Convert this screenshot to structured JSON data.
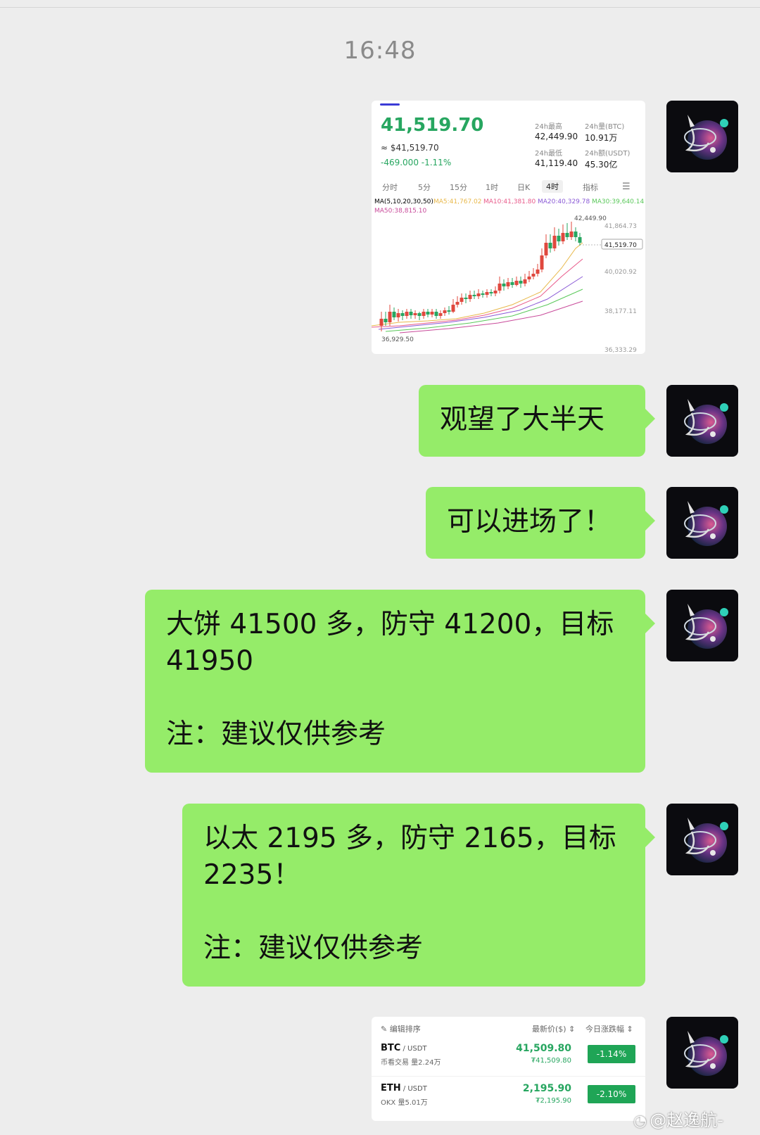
{
  "time": "16:48",
  "chart_card": {
    "price": "41,519.70",
    "usd": "≈ $41,519.70",
    "change": "-469.000  -1.11%",
    "stats": [
      {
        "label": "24h最高",
        "value": "42,449.90"
      },
      {
        "label": "24h量(BTC)",
        "value": "10.91万"
      },
      {
        "label": "24h最低",
        "value": "41,119.40"
      },
      {
        "label": "24h额(USDT)",
        "value": "45.30亿"
      }
    ],
    "tabs": [
      "分时",
      "5分",
      "15分",
      "1时",
      "日K",
      "4时",
      "指标"
    ],
    "active_tab": "4时",
    "ma_labels": [
      {
        "text": "MA(5,10,20,30,50)",
        "color": "#555555"
      },
      {
        "text": "MA5:41,767.02",
        "color": "#e8b84a"
      },
      {
        "text": "MA10:41,381.80",
        "color": "#e85a8a"
      },
      {
        "text": "MA20:40,329.78",
        "color": "#8a5ad6"
      },
      {
        "text": "MA30:39,640.14",
        "color": "#5ac85a"
      },
      {
        "text": "MA50:38,815.10",
        "color": "#c84a9a"
      }
    ],
    "axis_labels": [
      "41,864.73",
      "40,020.92",
      "38,177.11",
      "36,333.29"
    ],
    "high_label": "42,449.90",
    "low_label": "36,929.50",
    "current_label": "41,519.70"
  },
  "messages": [
    {
      "lines": [
        "观望了大半天"
      ]
    },
    {
      "lines": [
        "可以进场了！"
      ]
    },
    {
      "lines": [
        "大饼 41500 多，防守 41200，目标",
        "41950",
        "",
        "注：建议仅供参考"
      ]
    },
    {
      "lines": [
        "以太 2195 多，防守 2165，目标",
        "2235！",
        "",
        "注：建议仅供参考"
      ]
    }
  ],
  "market_card": {
    "edit_label": "编辑排序",
    "col_price": "最新价($) ⇕",
    "col_change": "今日涨跌幅 ⇕",
    "rows": [
      {
        "symbol": "BTC",
        "quote": " / USDT",
        "sub": "币看交易  量2.24万",
        "price": "41,509.80",
        "cny": "₮41,509.80",
        "change": "-1.14%"
      },
      {
        "symbol": "ETH",
        "quote": " / USDT",
        "sub": "OKX  量5.01万",
        "price": "2,195.90",
        "cny": "₮2,195.90",
        "change": "-2.10%"
      }
    ]
  },
  "watermark": "@赵逸航-",
  "colors": {
    "bubble": "#95ec69",
    "up": "#e0483e",
    "down": "#27a660"
  }
}
